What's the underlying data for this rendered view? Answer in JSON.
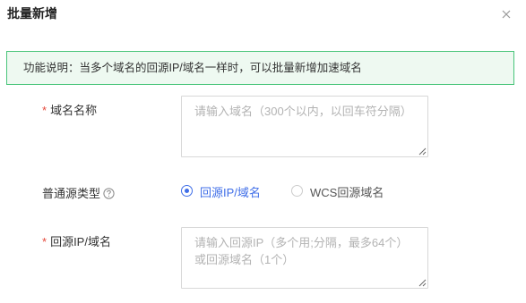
{
  "dialog": {
    "title": "批量新增",
    "close_icon": "close-icon"
  },
  "notice": {
    "text": "功能说明：当多个域名的回源IP/域名一样时，可以批量新增加速域名",
    "border_color": "#49c57a",
    "background_color": "#eef9f1"
  },
  "form": {
    "required_mark": "*",
    "domain_names": {
      "label": "域名名称",
      "placeholder": "请输入域名（300个以内，以回车符分隔）",
      "value": ""
    },
    "origin_type": {
      "label": "普通源类型",
      "help_icon": "question-circle-icon",
      "options": [
        {
          "label": "回源IP/域名",
          "selected": true
        },
        {
          "label": "WCS回源域名",
          "selected": false
        }
      ],
      "accent_color": "#3f6ee8"
    },
    "origin_address": {
      "label": "回源IP/域名",
      "placeholder_line1": "请输入回源IP（多个用;分隔，最多64个）",
      "placeholder_line2": "或回源域名（1个）",
      "value": ""
    }
  }
}
